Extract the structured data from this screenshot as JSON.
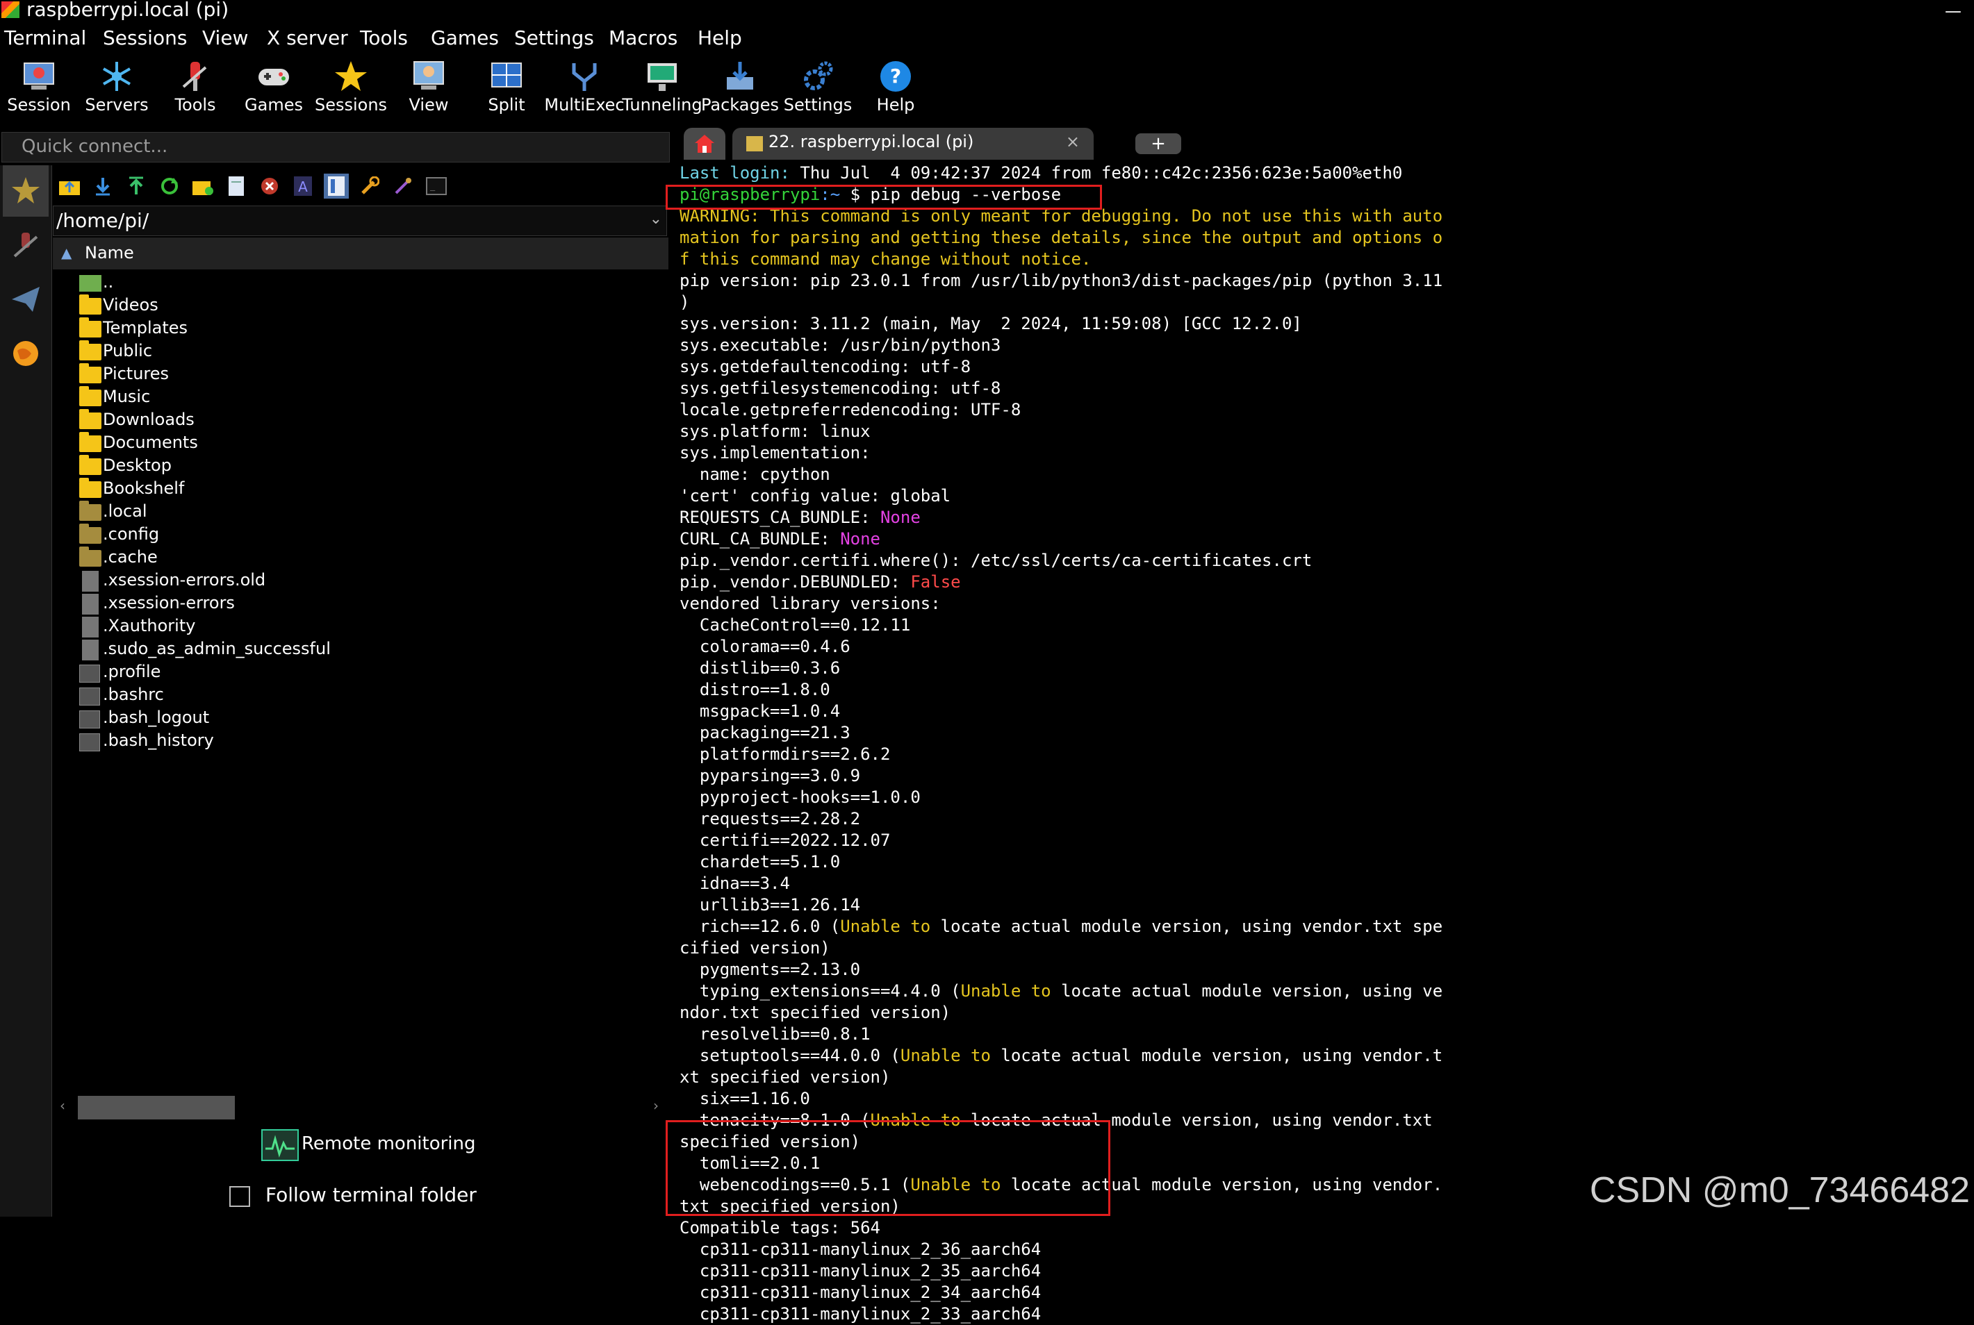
{
  "window": {
    "title": "raspberrypi.local (pi)",
    "minimize": "—"
  },
  "menu": [
    "Terminal",
    "Sessions",
    "View",
    "X server",
    "Tools",
    "Games",
    "Settings",
    "Macros",
    "Help"
  ],
  "toolbar": [
    "Session",
    "Servers",
    "Tools",
    "Games",
    "Sessions",
    "View",
    "Split",
    "MultiExec",
    "Tunneling",
    "Packages",
    "Settings",
    "Help"
  ],
  "quick_connect": {
    "placeholder": "Quick connect..."
  },
  "sftp": {
    "path": "/home/pi/",
    "column": "Name",
    "files": [
      {
        "name": "..",
        "type": "up"
      },
      {
        "name": "Videos",
        "type": "folder"
      },
      {
        "name": "Templates",
        "type": "folder"
      },
      {
        "name": "Public",
        "type": "folder"
      },
      {
        "name": "Pictures",
        "type": "folder"
      },
      {
        "name": "Music",
        "type": "folder"
      },
      {
        "name": "Downloads",
        "type": "folder"
      },
      {
        "name": "Documents",
        "type": "folder"
      },
      {
        "name": "Desktop",
        "type": "folder"
      },
      {
        "name": "Bookshelf",
        "type": "folder"
      },
      {
        "name": ".local",
        "type": "hfolder"
      },
      {
        "name": ".config",
        "type": "hfolder"
      },
      {
        "name": ".cache",
        "type": "hfolder"
      },
      {
        "name": ".xsession-errors.old",
        "type": "file"
      },
      {
        "name": ".xsession-errors",
        "type": "file"
      },
      {
        "name": ".Xauthority",
        "type": "file"
      },
      {
        "name": ".sudo_as_admin_successful",
        "type": "file"
      },
      {
        "name": ".profile",
        "type": "script"
      },
      {
        "name": ".bashrc",
        "type": "script"
      },
      {
        "name": ".bash_logout",
        "type": "script"
      },
      {
        "name": ".bash_history",
        "type": "script"
      }
    ],
    "remote_monitoring": "Remote monitoring",
    "follow_terminal": "Follow terminal folder"
  },
  "tabs": {
    "session_tab": "22. raspberrypi.local (pi)",
    "close": "×",
    "new": "+"
  },
  "terminal": {
    "lines": [
      [
        {
          "t": "Last login: ",
          "c": "cy"
        },
        {
          "t": "Thu Jul  4 09:42:37 2024 from fe80::c42c:2356:623e:5a00%eth0",
          "c": "w"
        }
      ],
      [
        {
          "t": "pi@raspberrypi",
          "c": "g"
        },
        {
          "t": ":~ ",
          "c": "b"
        },
        {
          "t": "$ pip debug --verbose",
          "c": "w"
        }
      ],
      [
        {
          "t": "WARNING: This command is only meant for debugging. Do not use this with auto",
          "c": "y"
        }
      ],
      [
        {
          "t": "mation for parsing and getting these details, since the output and options o",
          "c": "y"
        }
      ],
      [
        {
          "t": "f this command may change without notice.",
          "c": "y"
        }
      ],
      [
        {
          "t": "pip version: pip 23.0.1 from /usr/lib/python3/dist-packages/pip (python 3.11",
          "c": "w"
        }
      ],
      [
        {
          "t": ")",
          "c": "w"
        }
      ],
      [
        {
          "t": "sys.version: 3.11.2 (main, May  2 2024, 11:59:08) [GCC 12.2.0]",
          "c": "w"
        }
      ],
      [
        {
          "t": "sys.executable: /usr/bin/python3",
          "c": "w"
        }
      ],
      [
        {
          "t": "sys.getdefaultencoding: utf-8",
          "c": "w"
        }
      ],
      [
        {
          "t": "sys.getfilesystemencoding: utf-8",
          "c": "w"
        }
      ],
      [
        {
          "t": "locale.getpreferredencoding: UTF-8",
          "c": "w"
        }
      ],
      [
        {
          "t": "sys.platform: linux",
          "c": "w"
        }
      ],
      [
        {
          "t": "sys.implementation:",
          "c": "w"
        }
      ],
      [
        {
          "t": "  name: cpython",
          "c": "w"
        }
      ],
      [
        {
          "t": "'cert' config value: global",
          "c": "w"
        }
      ],
      [
        {
          "t": "REQUESTS_CA_BUNDLE: ",
          "c": "w"
        },
        {
          "t": "None",
          "c": "m"
        }
      ],
      [
        {
          "t": "CURL_CA_BUNDLE: ",
          "c": "w"
        },
        {
          "t": "None",
          "c": "m"
        }
      ],
      [
        {
          "t": "pip._vendor.certifi.where(): /etc/ssl/certs/ca-certificates.crt",
          "c": "w"
        }
      ],
      [
        {
          "t": "pip._vendor.DEBUNDLED: ",
          "c": "w"
        },
        {
          "t": "False",
          "c": "r"
        }
      ],
      [
        {
          "t": "vendored library versions:",
          "c": "w"
        }
      ],
      [
        {
          "t": "  CacheControl==0.12.11",
          "c": "w"
        }
      ],
      [
        {
          "t": "  colorama==0.4.6",
          "c": "w"
        }
      ],
      [
        {
          "t": "  distlib==0.3.6",
          "c": "w"
        }
      ],
      [
        {
          "t": "  distro==1.8.0",
          "c": "w"
        }
      ],
      [
        {
          "t": "  msgpack==1.0.4",
          "c": "w"
        }
      ],
      [
        {
          "t": "  packaging==21.3",
          "c": "w"
        }
      ],
      [
        {
          "t": "  platformdirs==2.6.2",
          "c": "w"
        }
      ],
      [
        {
          "t": "  pyparsing==3.0.9",
          "c": "w"
        }
      ],
      [
        {
          "t": "  pyproject-hooks==1.0.0",
          "c": "w"
        }
      ],
      [
        {
          "t": "  requests==2.28.2",
          "c": "w"
        }
      ],
      [
        {
          "t": "  certifi==2022.12.07",
          "c": "w"
        }
      ],
      [
        {
          "t": "  chardet==5.1.0",
          "c": "w"
        }
      ],
      [
        {
          "t": "  idna==3.4",
          "c": "w"
        }
      ],
      [
        {
          "t": "  urllib3==1.26.14",
          "c": "w"
        }
      ],
      [
        {
          "t": "  rich==12.6.0 (",
          "c": "w"
        },
        {
          "t": "Unable to",
          "c": "y"
        },
        {
          "t": " locate actual module version, using vendor.txt spe",
          "c": "w"
        }
      ],
      [
        {
          "t": "cified version)",
          "c": "w"
        }
      ],
      [
        {
          "t": "  pygments==2.13.0",
          "c": "w"
        }
      ],
      [
        {
          "t": "  typing_extensions==4.4.0 (",
          "c": "w"
        },
        {
          "t": "Unable to",
          "c": "y"
        },
        {
          "t": " locate actual module version, using ve",
          "c": "w"
        }
      ],
      [
        {
          "t": "ndor.txt specified version)",
          "c": "w"
        }
      ],
      [
        {
          "t": "  resolvelib==0.8.1",
          "c": "w"
        }
      ],
      [
        {
          "t": "  setuptools==44.0.0 (",
          "c": "w"
        },
        {
          "t": "Unable to",
          "c": "y"
        },
        {
          "t": " locate actual module version, using vendor.t",
          "c": "w"
        }
      ],
      [
        {
          "t": "xt specified version)",
          "c": "w"
        }
      ],
      [
        {
          "t": "  six==1.16.0",
          "c": "w"
        }
      ],
      [
        {
          "t": "  tenacity==8.1.0 (",
          "c": "w"
        },
        {
          "t": "Unable to",
          "c": "y"
        },
        {
          "t": " locate actual module version, using vendor.txt",
          "c": "w"
        }
      ],
      [
        {
          "t": "specified version)",
          "c": "w"
        }
      ],
      [
        {
          "t": "  tomli==2.0.1",
          "c": "w"
        }
      ],
      [
        {
          "t": "  webencodings==0.5.1 (",
          "c": "w"
        },
        {
          "t": "Unable to",
          "c": "y"
        },
        {
          "t": " locate actual module version, using vendor.",
          "c": "w"
        }
      ],
      [
        {
          "t": "txt specified version)",
          "c": "w"
        }
      ],
      [
        {
          "t": "Compatible tags: 564",
          "c": "w"
        }
      ],
      [
        {
          "t": "  cp311-cp311-manylinux_2_36_aarch64",
          "c": "w"
        }
      ],
      [
        {
          "t": "  cp311-cp311-manylinux_2_35_aarch64",
          "c": "w"
        }
      ],
      [
        {
          "t": "  cp311-cp311-manylinux_2_34_aarch64",
          "c": "w"
        }
      ],
      [
        {
          "t": "  cp311-cp311-manylinux_2_33_aarch64",
          "c": "w"
        }
      ]
    ]
  },
  "watermark": "CSDN @m0_73466482"
}
